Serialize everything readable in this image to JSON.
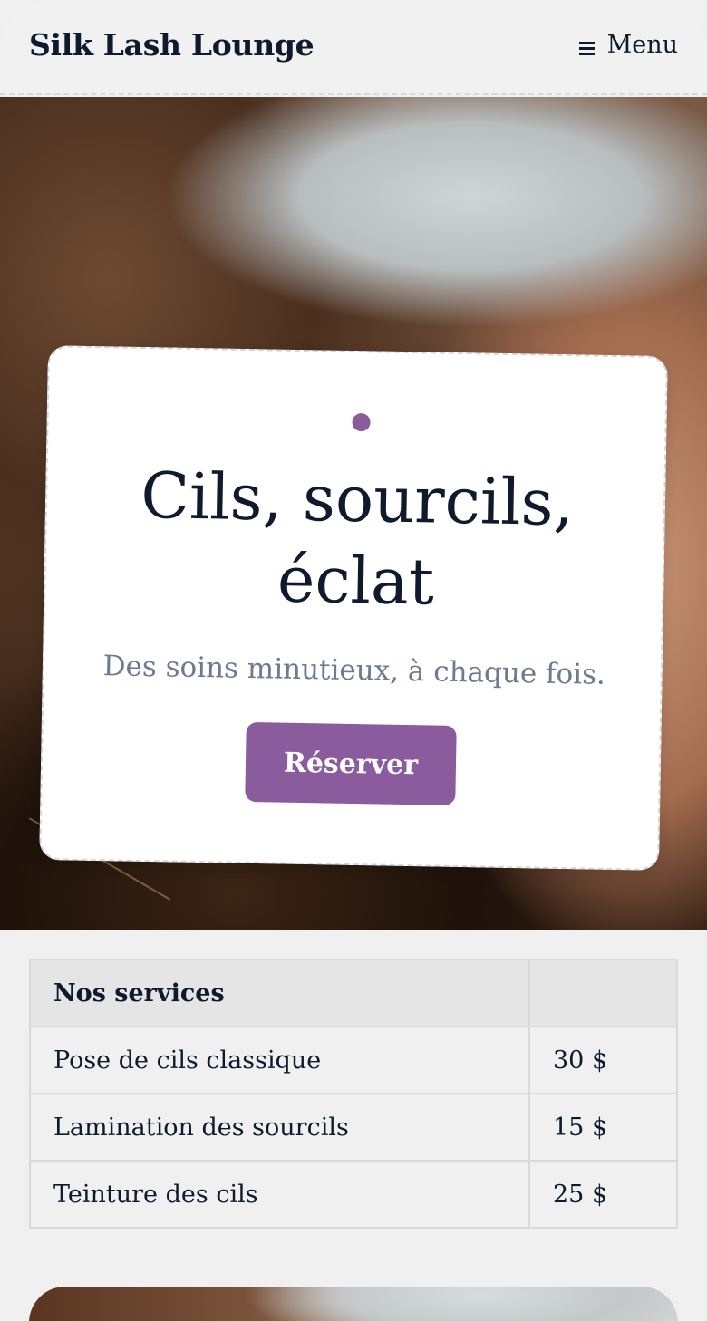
{
  "header": {
    "brand": "Silk Lash Lounge",
    "menu_label": "Menu",
    "menu_icon": "hamburger-icon"
  },
  "hero": {
    "title": "Cils, sourcils, éclat",
    "subtitle": "Des soins minutieux, à chaque fois.",
    "cta_label": "Réserver",
    "accent_dot_icon": "dot-icon"
  },
  "services": {
    "header": "Nos services",
    "price_header": "",
    "rows": [
      {
        "name": "Pose de cils classique",
        "price": "30 $"
      },
      {
        "name": "Lamination des sourcils",
        "price": "15 $"
      },
      {
        "name": "Teinture des cils",
        "price": "25 $"
      }
    ]
  },
  "colors": {
    "accent": "#8a5c9e",
    "text": "#0f1b2d",
    "muted": "#6e7a90",
    "background": "#f0f0f0"
  }
}
